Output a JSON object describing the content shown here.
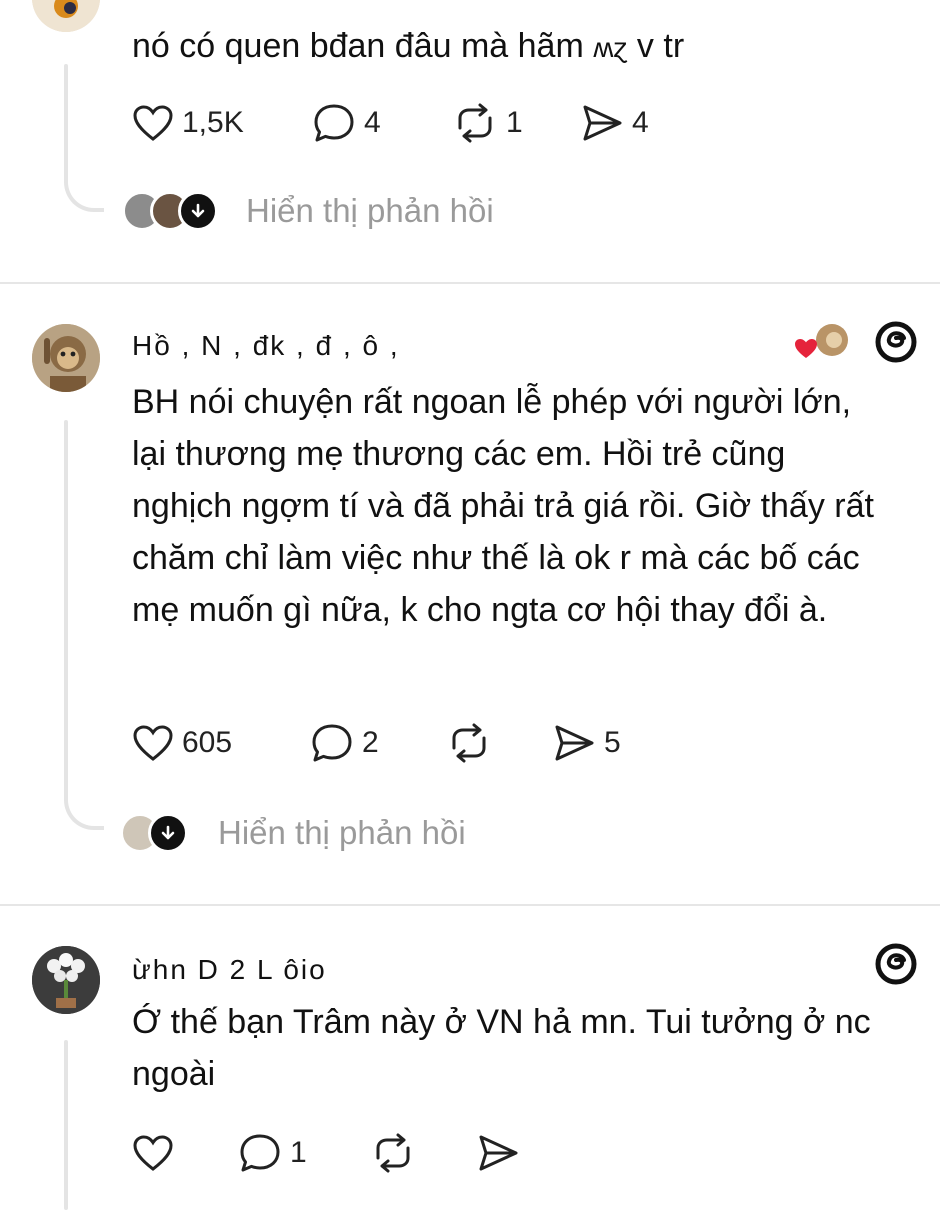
{
  "posts": [
    {
      "text": "nó có quen bđan đâu mà hãm",
      "text_trailing": "v tr",
      "likes": "1,5K",
      "comments": "4",
      "reposts": "1",
      "shares": "4",
      "show_replies": "Hiển thị phản hồi"
    },
    {
      "username": "Hồ , N , đk , đ , ô ,",
      "text": "BH nói chuyện rất ngoan lễ phép với người lớn, lại thương mẹ thương các em. Hồi trẻ cũng nghịch ngợm tí và đã phải trả giá rồi. Giờ thấy rất chăm chỉ làm việc như thế là ok r mà các bố các mẹ muốn gì nữa, k cho ngta cơ hội thay đổi à.",
      "likes": "605",
      "comments": "2",
      "reposts": "",
      "shares": "5",
      "show_replies": "Hiển thị phản hồi"
    },
    {
      "username": "ừhn  D  2 L  ôio",
      "text": "Ớ thế bạn Trâm này ở VN hả mn. Tui tưởng ở nc ngoài",
      "likes": "",
      "comments": "1",
      "reposts": "",
      "shares": ""
    }
  ],
  "icons": {
    "like": "heart-outline-icon",
    "comment": "speech-bubble-icon",
    "repost": "repost-arrows-icon",
    "share": "paper-plane-icon",
    "threads": "threads-logo-icon",
    "reaction": "red-heart-icon"
  },
  "colors": {
    "reaction_heart": "#e5233b",
    "muted_text": "#9a9a9a",
    "divider": "#e6e6e6"
  }
}
